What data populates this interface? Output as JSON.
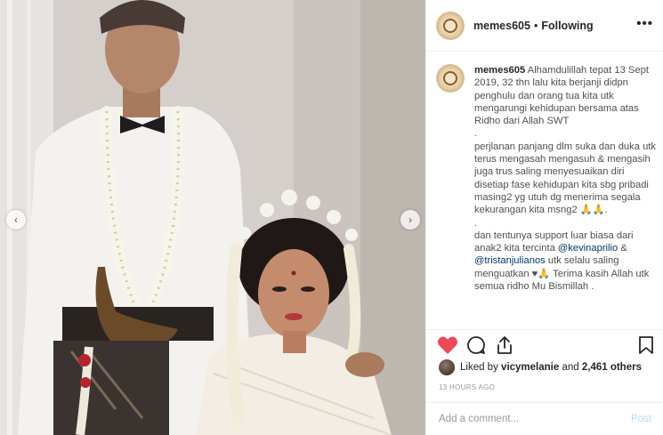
{
  "header": {
    "username": "memes605",
    "separator": "•",
    "follow_status": "Following",
    "more_icon": "ellipsis-icon",
    "more_label": "•••"
  },
  "caption": {
    "username": "memes605",
    "line1": "Alhamdulillah tepat 13 Sept 2019, 32 thn lalu kita berjanji didpn penghulu dan orang tua kita utk mengarungi kehidupan bersama atas Ridho dari Allah SWT",
    "line2": ".",
    "line3": "perjlanan panjang dlm suka dan duka utk terus mengasah mengasuh & mengasih juga trus saling menyesuaikan diri disetiap fase kehidupan kita sbg pribadi masing2 yg utuh dg menerima segala kekurangan kita msng2 🙏🙏.",
    "line4": ".",
    "line5_pre": "dan tentunya support luar biasa dari anak2 kita tercinta",
    "mention1": "@kevinaprilio",
    "line5_mid": "&",
    "mention2": "@tristanjulianos",
    "line5_post": "utk selalu saling menguatkan ♥🙏 Terima kasih Allah utk semua ridho Mu Bismillah ."
  },
  "actions": {
    "like_icon": "heart-icon",
    "comment_icon": "comment-icon",
    "share_icon": "share-icon",
    "save_icon": "bookmark-icon",
    "like_color": "#ed4956"
  },
  "likes": {
    "prefix": "Liked by",
    "user": "vicymelanie",
    "and": "and",
    "count": "2,461 others"
  },
  "timestamp": "13 HOURS AGO",
  "comment": {
    "placeholder": "Add a comment...",
    "post_label": "Post"
  },
  "navigation": {
    "prev_icon": "chevron-left-icon",
    "next_icon": "chevron-right-icon",
    "prev_glyph": "‹",
    "next_glyph": "›"
  }
}
